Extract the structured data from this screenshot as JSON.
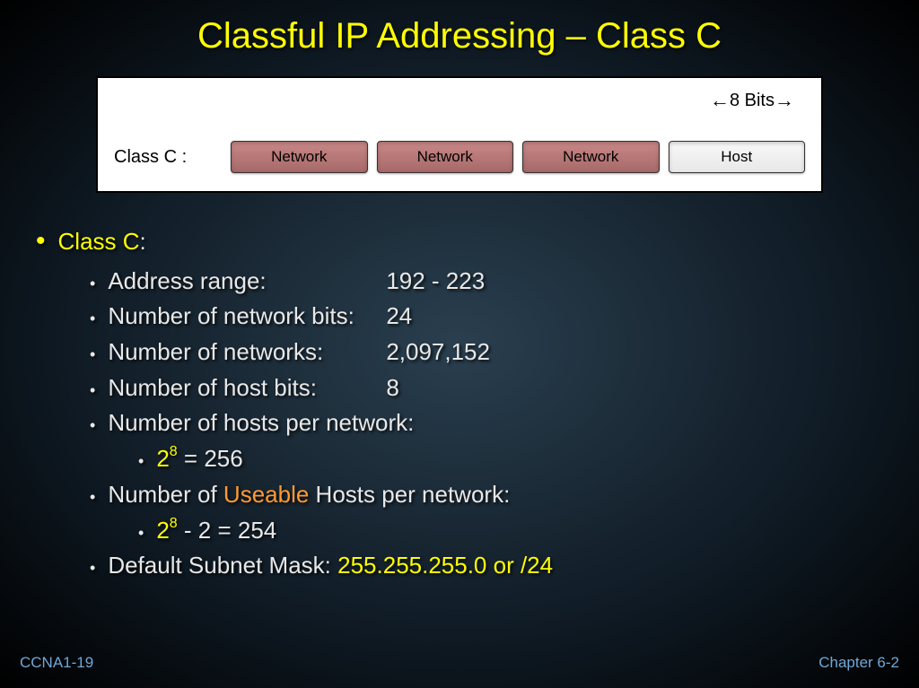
{
  "title": "Classful IP Addressing – Class C",
  "diagram": {
    "bits_label": "8 Bits",
    "class_label": "Class C :",
    "octets": [
      {
        "text": "Network",
        "type": "network"
      },
      {
        "text": "Network",
        "type": "network"
      },
      {
        "text": "Network",
        "type": "network"
      },
      {
        "text": "Host",
        "type": "host"
      }
    ]
  },
  "main_bullet": {
    "label": "Class C",
    "suffix": ":"
  },
  "items": {
    "addr_range": {
      "label": "Address range:",
      "value": "192  -  223"
    },
    "net_bits": {
      "label": "Number of network bits:",
      "value": "24"
    },
    "networks": {
      "label": "Number of networks:",
      "value": "2,097,152"
    },
    "host_bits": {
      "label": "Number of host bits:",
      "value": "8"
    },
    "hosts_per": {
      "label": "Number of hosts per network:"
    },
    "hosts_calc": {
      "base": "2",
      "exp": "8",
      "rest": "  =  256"
    },
    "useable_pre": "Number of ",
    "useable_word": "Useable",
    "useable_post": " Hosts per network:",
    "useable_calc": {
      "base": "2",
      "exp": "8",
      "rest": "  -  2  =  254"
    },
    "subnet": {
      "label": "Default Subnet Mask:  ",
      "value": "255.255.255.0   or   /24"
    }
  },
  "footer": {
    "left": "CCNA1-19",
    "right": "Chapter 6-2"
  }
}
